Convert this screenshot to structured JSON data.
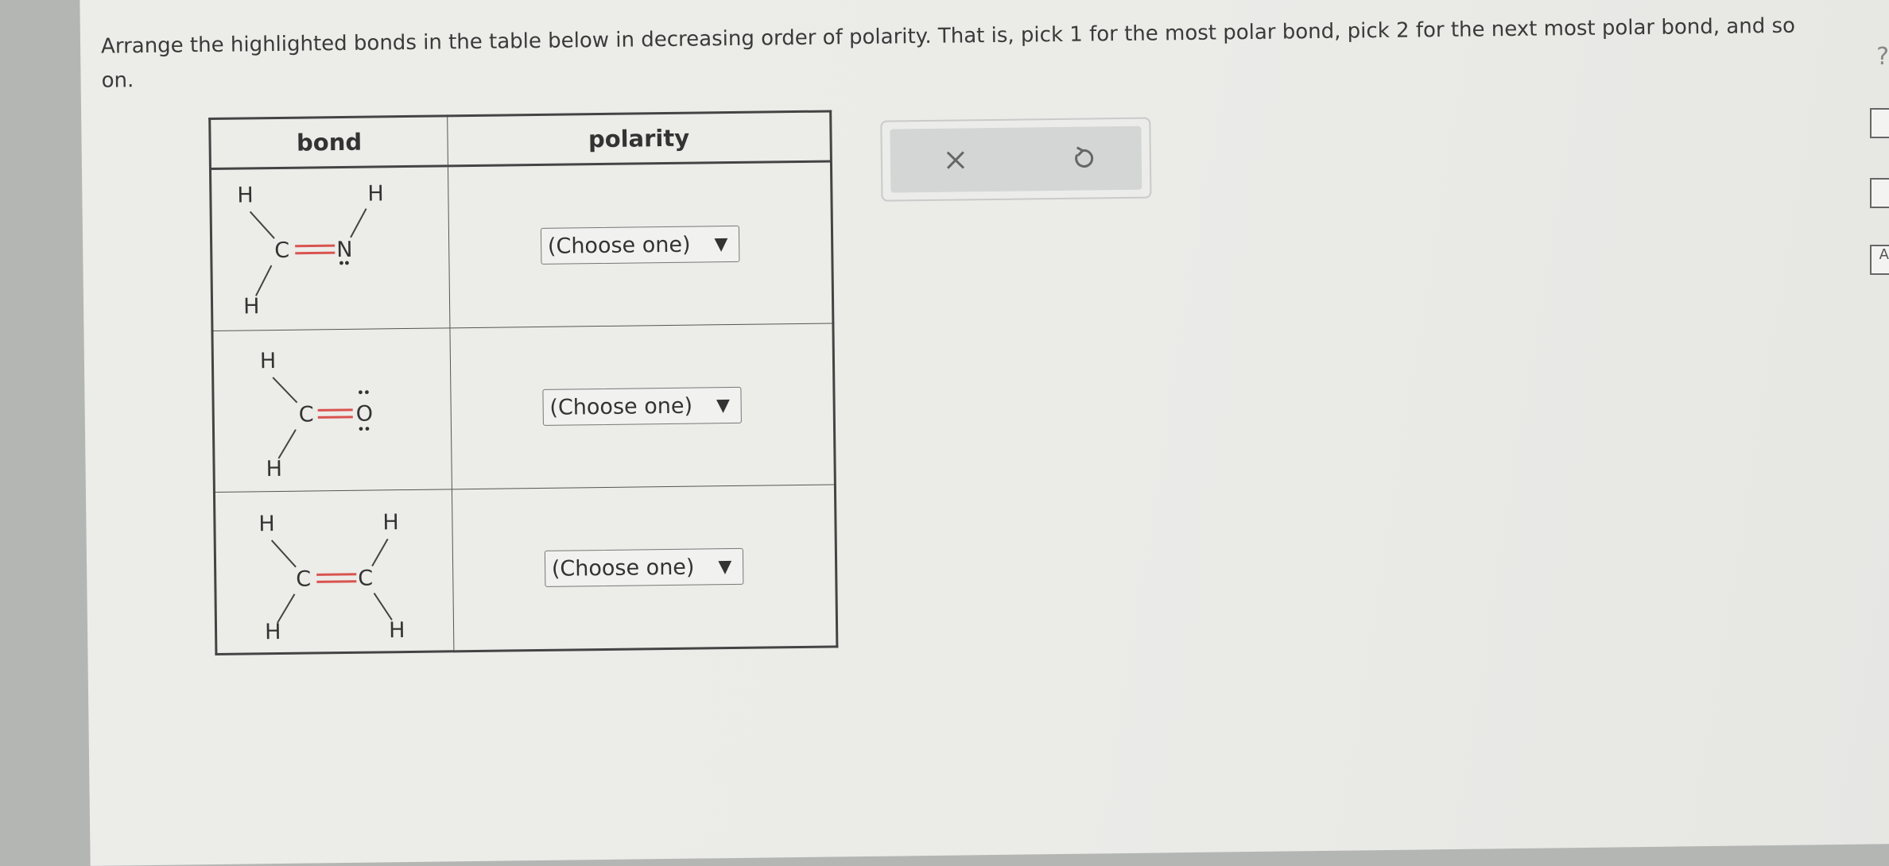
{
  "prompt": {
    "text": "Arrange the highlighted bonds in the table below in decreasing order of polarity. That is, pick 1 for the most polar bond, pick 2 for the next most polar bond, and so on."
  },
  "table": {
    "headers": {
      "bond": "bond",
      "polarity": "polarity"
    },
    "rows": [
      {
        "bond": "C=N",
        "atoms": {
          "H": "H",
          "C": "C",
          "N": "N"
        },
        "select_value": "(Choose one)"
      },
      {
        "bond": "C=O",
        "atoms": {
          "H": "H",
          "C": "C",
          "O": "O"
        },
        "select_value": "(Choose one)"
      },
      {
        "bond": "C=C",
        "atoms": {
          "H": "H",
          "C": "C"
        },
        "select_value": "(Choose one)"
      }
    ]
  },
  "actions": {
    "clear": "clear-icon",
    "undo": "undo-icon"
  },
  "sidebar": {
    "help": "?",
    "tools": [
      "calculator-icon",
      "chart-icon",
      "periodic-table-icon"
    ],
    "periodic_letter": "A"
  },
  "colors": {
    "highlighted_bond": "#d9534f",
    "bond_line": "#444444"
  }
}
